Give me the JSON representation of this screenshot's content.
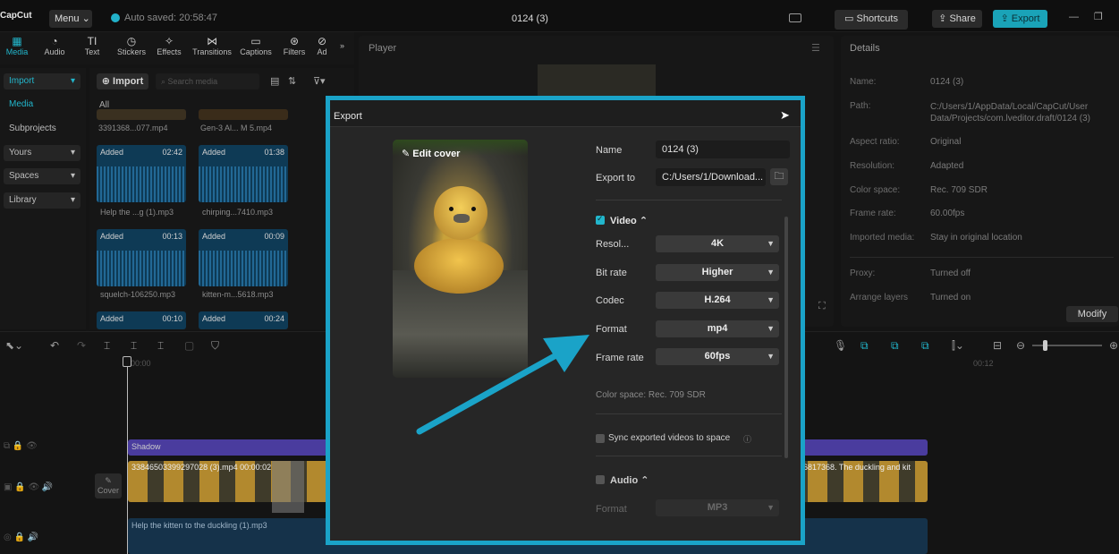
{
  "titlebar": {
    "logo": "CapCut",
    "menu": "Menu",
    "autosave": "Auto saved: 20:58:47",
    "project_title": "0124 (3)",
    "shortcuts": "Shortcuts",
    "share": "Share",
    "export": "Export"
  },
  "toolbar": {
    "tools": [
      {
        "label": "Media",
        "icon": "media-icon"
      },
      {
        "label": "Audio",
        "icon": "audio-icon"
      },
      {
        "label": "Text",
        "icon": "text-icon"
      },
      {
        "label": "Stickers",
        "icon": "stickers-icon"
      },
      {
        "label": "Effects",
        "icon": "effects-icon"
      },
      {
        "label": "Transitions",
        "icon": "transitions-icon"
      },
      {
        "label": "Captions",
        "icon": "captions-icon"
      },
      {
        "label": "Filters",
        "icon": "filters-icon"
      },
      {
        "label": "Ad",
        "icon": "adjust-icon"
      }
    ]
  },
  "sidebar": {
    "items": [
      "Import",
      "Media",
      "Subprojects",
      "Yours",
      "Spaces",
      "Library"
    ]
  },
  "media": {
    "import_button": "Import",
    "search_placeholder": "Search media",
    "filter_all": "All",
    "items": [
      {
        "name": "3391368...077.mp4",
        "badge": "",
        "duration": ""
      },
      {
        "name": "Gen-3 Al... M 5.mp4",
        "badge": "",
        "duration": ""
      },
      {
        "name": "Help the ...g (1).mp3",
        "badge": "Added",
        "duration": "02:42"
      },
      {
        "name": "chirping...7410.mp3",
        "badge": "Added",
        "duration": "01:38"
      },
      {
        "name": "squelch-106250.mp3",
        "badge": "Added",
        "duration": "00:13"
      },
      {
        "name": "kitten-m...5618.mp3",
        "badge": "Added",
        "duration": "00:09"
      },
      {
        "name": "",
        "badge": "Added",
        "duration": "00:10"
      },
      {
        "name": "",
        "badge": "Added",
        "duration": "00:24"
      }
    ]
  },
  "player": {
    "title": "Player"
  },
  "details": {
    "title": "Details",
    "rows": [
      {
        "key": "Name:",
        "value": "0124 (3)"
      },
      {
        "key": "Path:",
        "value": "C:/Users/1/AppData/Local/CapCut/User Data/Projects/com.lveditor.draft/0124 (3)"
      },
      {
        "key": "Aspect ratio:",
        "value": "Original"
      },
      {
        "key": "Resolution:",
        "value": "Adapted"
      },
      {
        "key": "Color space:",
        "value": "Rec. 709 SDR"
      },
      {
        "key": "Frame rate:",
        "value": "60.00fps"
      },
      {
        "key": "Imported media:",
        "value": "Stay in original location"
      },
      {
        "key": "Proxy:",
        "value": "Turned off"
      },
      {
        "key": "Arrange layers",
        "value": "Turned on"
      }
    ],
    "modify": "Modify"
  },
  "timeline": {
    "time_start": "00:00",
    "time_end": "00:12",
    "shadow_label": "Shadow",
    "video_clip": "3384650339929702​8 (3).mp4  00:00:02",
    "video_clip_right": "26817368. The duckling and kit",
    "audio_clip": "Help the kitten to the duckling (1).mp3",
    "cover": "Cover"
  },
  "export_dialog": {
    "title": "Export",
    "edit_cover": "Edit cover",
    "name_label": "Name",
    "name_value": "0124 (3)",
    "export_to_label": "Export to",
    "export_to_value": "C:/Users/1/Download...",
    "video_section": "Video",
    "video_checked": true,
    "resolution_label": "Resol...",
    "resolution_value": "4K",
    "bitrate_label": "Bit rate",
    "bitrate_value": "Higher",
    "codec_label": "Codec",
    "codec_value": "H.264",
    "format_label": "Format",
    "format_value": "mp4",
    "framerate_label": "Frame rate",
    "framerate_value": "60fps",
    "color_space": "Color space: Rec. 709 SDR",
    "sync_label": "Sync exported videos to space",
    "audio_section": "Audio",
    "audio_format_label": "Format",
    "audio_format_value": "MP3"
  },
  "colors": {
    "accent": "#1aa3c8",
    "arrow": "#1aa3c8",
    "checkbox": "#22b6cc"
  }
}
